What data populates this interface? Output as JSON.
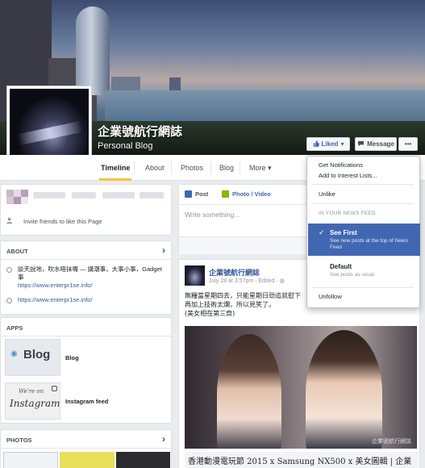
{
  "page": {
    "name": "企業號航行網誌",
    "category": "Personal Blog"
  },
  "actions": {
    "liked_label": "Liked",
    "message_label": "Message",
    "more_label": "•••"
  },
  "tabs": [
    {
      "label": "Timeline",
      "active": true
    },
    {
      "label": "About"
    },
    {
      "label": "Photos"
    },
    {
      "label": "Blog"
    },
    {
      "label": "More"
    }
  ],
  "likes_card": {
    "invite_text": "Invite friends to like this Page"
  },
  "about": {
    "heading": "ABOUT",
    "description": "談天說地，吹水唔抹嘴 — 講潮事，大事小事，Gadget事",
    "link1": "https://www.enterpr1se.info/",
    "link2": "https://www.enterpr1se.info/"
  },
  "apps": {
    "heading": "APPS",
    "items": [
      {
        "label": "Blog",
        "thumb_text": "Blog"
      },
      {
        "label": "Instagram feed",
        "thumb_small": "We're on",
        "thumb_text": "Instagram"
      }
    ]
  },
  "photos": {
    "heading": "PHOTOS"
  },
  "composer": {
    "post_tab": "Post",
    "photo_tab": "Photo / Video",
    "placeholder": "Write something..."
  },
  "post": {
    "author": "企業號航行網誌",
    "meta": "July 28 at 3:57pm · Edited · ",
    "text_line1": "無糧當星期四去，只能星期日劲追就慰下",
    "text_line2": "再加上技術太爛，所以見笑了。",
    "text_line3": "(美女相在第三齊)",
    "caption": "香港動漫電玩節 2015 x Samsung NX500 x 美女圖輯 | 企業號航行網誌"
  },
  "dropdown": {
    "get_notifications": "Get Notifications",
    "add_to_interest": "Add to Interest Lists...",
    "unlike": "Unlike",
    "section_label": "IN YOUR NEWS FEED",
    "see_first_title": "See First",
    "see_first_desc": "See new posts at the top of News Feed",
    "default_title": "Default",
    "default_desc": "See posts as usual",
    "unfollow": "Unfollow"
  },
  "colors": {
    "brand_blue": "#4267b2",
    "link_blue": "#365899",
    "tab_underline": "#f5c33b",
    "page_bg": "#e9ebee"
  }
}
